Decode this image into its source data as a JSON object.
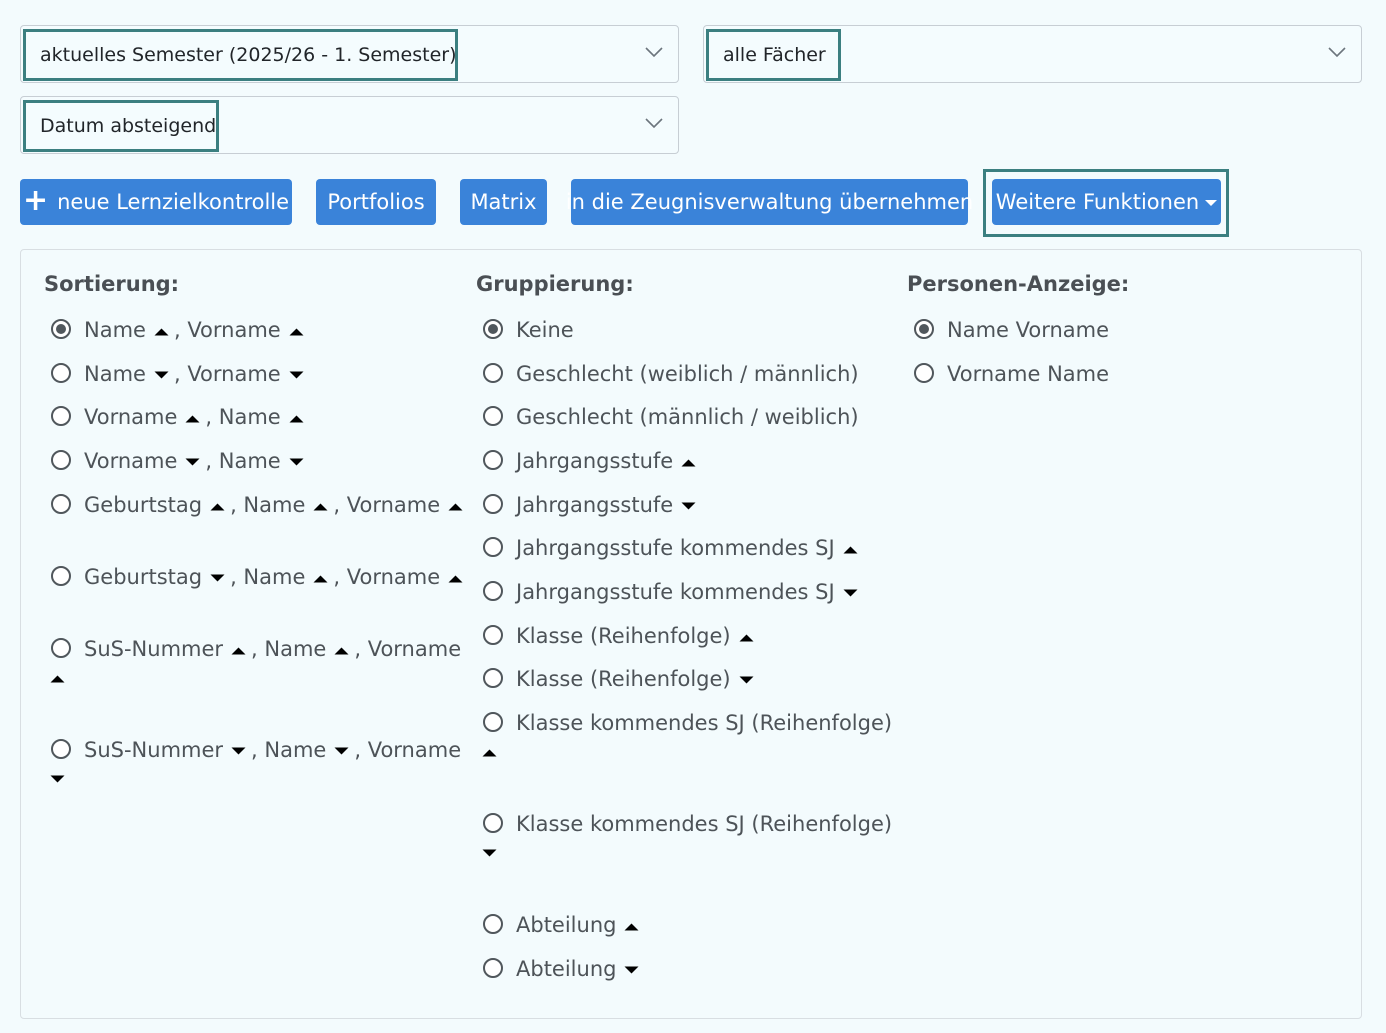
{
  "filters": {
    "semester": "aktuelles Semester (2025/26 - 1. Semester)",
    "subjects": "alle Fächer",
    "order": "Datum absteigend"
  },
  "toolbar": {
    "new_label": "neue Lernzielkontrolle",
    "portfolios_label": "Portfolios",
    "matrix_label": "Matrix",
    "transfer_label": "in die Zeugnisverwaltung übernehmen",
    "more_label": "Weitere Funktionen"
  },
  "sorting": {
    "title": "Sortierung:",
    "options": [
      {
        "label": "Name ▲ , Vorname ▲",
        "checked": true
      },
      {
        "label": "Name ▼ , Vorname ▼",
        "checked": false
      },
      {
        "label": "Vorname ▲ , Name ▲",
        "checked": false
      },
      {
        "label": "Vorname ▼ , Name ▼",
        "checked": false
      },
      {
        "label": "Geburtstag ▲ , Name ▲ , Vorname ▲",
        "checked": false
      },
      {
        "label": "Geburtstag ▼ , Name ▲ , Vorname ▲",
        "checked": false
      },
      {
        "label": "SuS-Nummer ▲ , Name ▲ , Vorname ▲",
        "checked": false
      },
      {
        "label": "SuS-Nummer ▼ , Name ▼ , Vorname ▼",
        "checked": false
      }
    ]
  },
  "grouping": {
    "title": "Gruppierung:",
    "options": [
      {
        "label": "Keine",
        "checked": true
      },
      {
        "label": "Geschlecht (weiblich / männlich)",
        "checked": false
      },
      {
        "label": "Geschlecht (männlich / weiblich)",
        "checked": false
      },
      {
        "label": "Jahrgangsstufe ▲",
        "checked": false
      },
      {
        "label": "Jahrgangsstufe ▼",
        "checked": false
      },
      {
        "label": "Jahrgangsstufe kommendes SJ ▲",
        "checked": false
      },
      {
        "label": "Jahrgangsstufe kommendes SJ ▼",
        "checked": false
      },
      {
        "label": "Klasse (Reihenfolge) ▲",
        "checked": false
      },
      {
        "label": "Klasse (Reihenfolge) ▼",
        "checked": false
      },
      {
        "label": "Klasse kommendes SJ (Reihenfolge) ▲",
        "checked": false
      },
      {
        "label": "Klasse kommendes SJ (Reihenfolge) ▼",
        "checked": false
      },
      {
        "label": "Abteilung ▲",
        "checked": false
      },
      {
        "label": "Abteilung ▼",
        "checked": false
      }
    ]
  },
  "display": {
    "title": "Personen-Anzeige:",
    "options": [
      {
        "label": "Name Vorname",
        "checked": true
      },
      {
        "label": "Vorname Name",
        "checked": false
      }
    ]
  },
  "icons": {
    "sort_up": "chevron-up-icon",
    "sort_down": "chevron-down-icon",
    "dropdown": "chevron-down-icon",
    "add": "plus-icon"
  },
  "colors": {
    "button": "#3a83d9",
    "focus": "#3b7f80",
    "background": "#f3fbfd"
  }
}
